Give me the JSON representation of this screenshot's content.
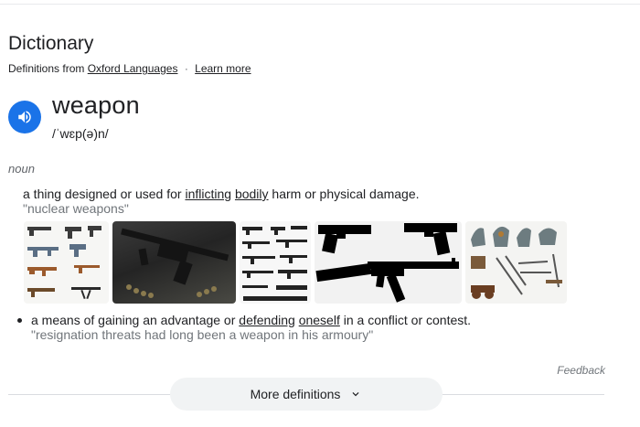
{
  "heading": "Dictionary",
  "source": {
    "prefix": "Definitions from",
    "provider_link": "Oxford Languages",
    "separator": "·",
    "learn_more": "Learn more"
  },
  "entry": {
    "word": "weapon",
    "phonetic": "/ˈwɛp(ə)n/",
    "part_of_speech": "noun"
  },
  "definitions": [
    {
      "parts": [
        "a thing designed or used for ",
        "inflicting",
        " ",
        "bodily",
        " harm or physical damage."
      ],
      "example": "\"nuclear weapons\""
    },
    {
      "parts": [
        "a means of gaining an advantage or ",
        "defending",
        " ",
        "oneself",
        " in a conflict or contest."
      ],
      "example": "\"resignation threats had long been a weapon in his armoury\""
    }
  ],
  "images": [
    "firearm-types-chart",
    "assault-rifle-photo",
    "firearm-silhouettes-grid",
    "pistol-and-rifle-silhouettes",
    "medieval-weapons-illustration"
  ],
  "feedback": "Feedback",
  "more_definitions": "More definitions",
  "colors": {
    "accent": "#1a73e8",
    "text": "#202124",
    "muted": "#70757a",
    "button_bg": "#f1f3f4"
  }
}
